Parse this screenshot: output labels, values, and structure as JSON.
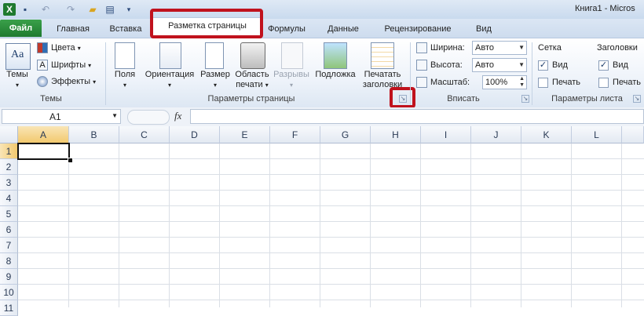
{
  "window": {
    "title": "Книга1  -  Micros"
  },
  "tabs": {
    "file": "Файл",
    "items": [
      "Главная",
      "Вставка",
      "Разметка страницы",
      "Формулы",
      "Данные",
      "Рецензирование",
      "Вид"
    ],
    "active": "Разметка страницы"
  },
  "ribbon": {
    "themes_group": {
      "label": "Темы",
      "themes_button": "Темы",
      "colors": "Цвета",
      "fonts": "Шрифты",
      "effects": "Эффекты"
    },
    "page_setup_group": {
      "label": "Параметры страницы",
      "margins": "Поля",
      "orientation": "Ориентация",
      "size": "Размер",
      "print_area_line1": "Область",
      "print_area_line2": "печати",
      "breaks": "Разрывы",
      "background": "Подложка",
      "print_titles_line1": "Печатать",
      "print_titles_line2": "заголовки"
    },
    "fit_group": {
      "label": "Вписать",
      "width_label": "Ширина:",
      "width_value": "Авто",
      "height_label": "Высота:",
      "height_value": "Авто",
      "scale_label": "Масштаб:",
      "scale_value": "100%"
    },
    "sheet_options_group": {
      "label": "Параметры листа",
      "gridlines": "Сетка",
      "headings": "Заголовки",
      "view": "Вид",
      "print": "Печать",
      "gridlines_view_checked": true,
      "headings_view_checked": true
    }
  },
  "formula_bar": {
    "name_box": "A1",
    "fx": "fx",
    "formula": ""
  },
  "grid": {
    "columns": [
      "A",
      "B",
      "C",
      "D",
      "E",
      "F",
      "G",
      "H",
      "I",
      "J",
      "K",
      "L"
    ],
    "rows": [
      "1",
      "2",
      "3",
      "4",
      "5",
      "6",
      "7",
      "8",
      "9",
      "10",
      "11"
    ],
    "selected_cell": "A1"
  },
  "colors": {
    "highlight": "#c0121d",
    "file_tab": "#2a8a3a"
  }
}
